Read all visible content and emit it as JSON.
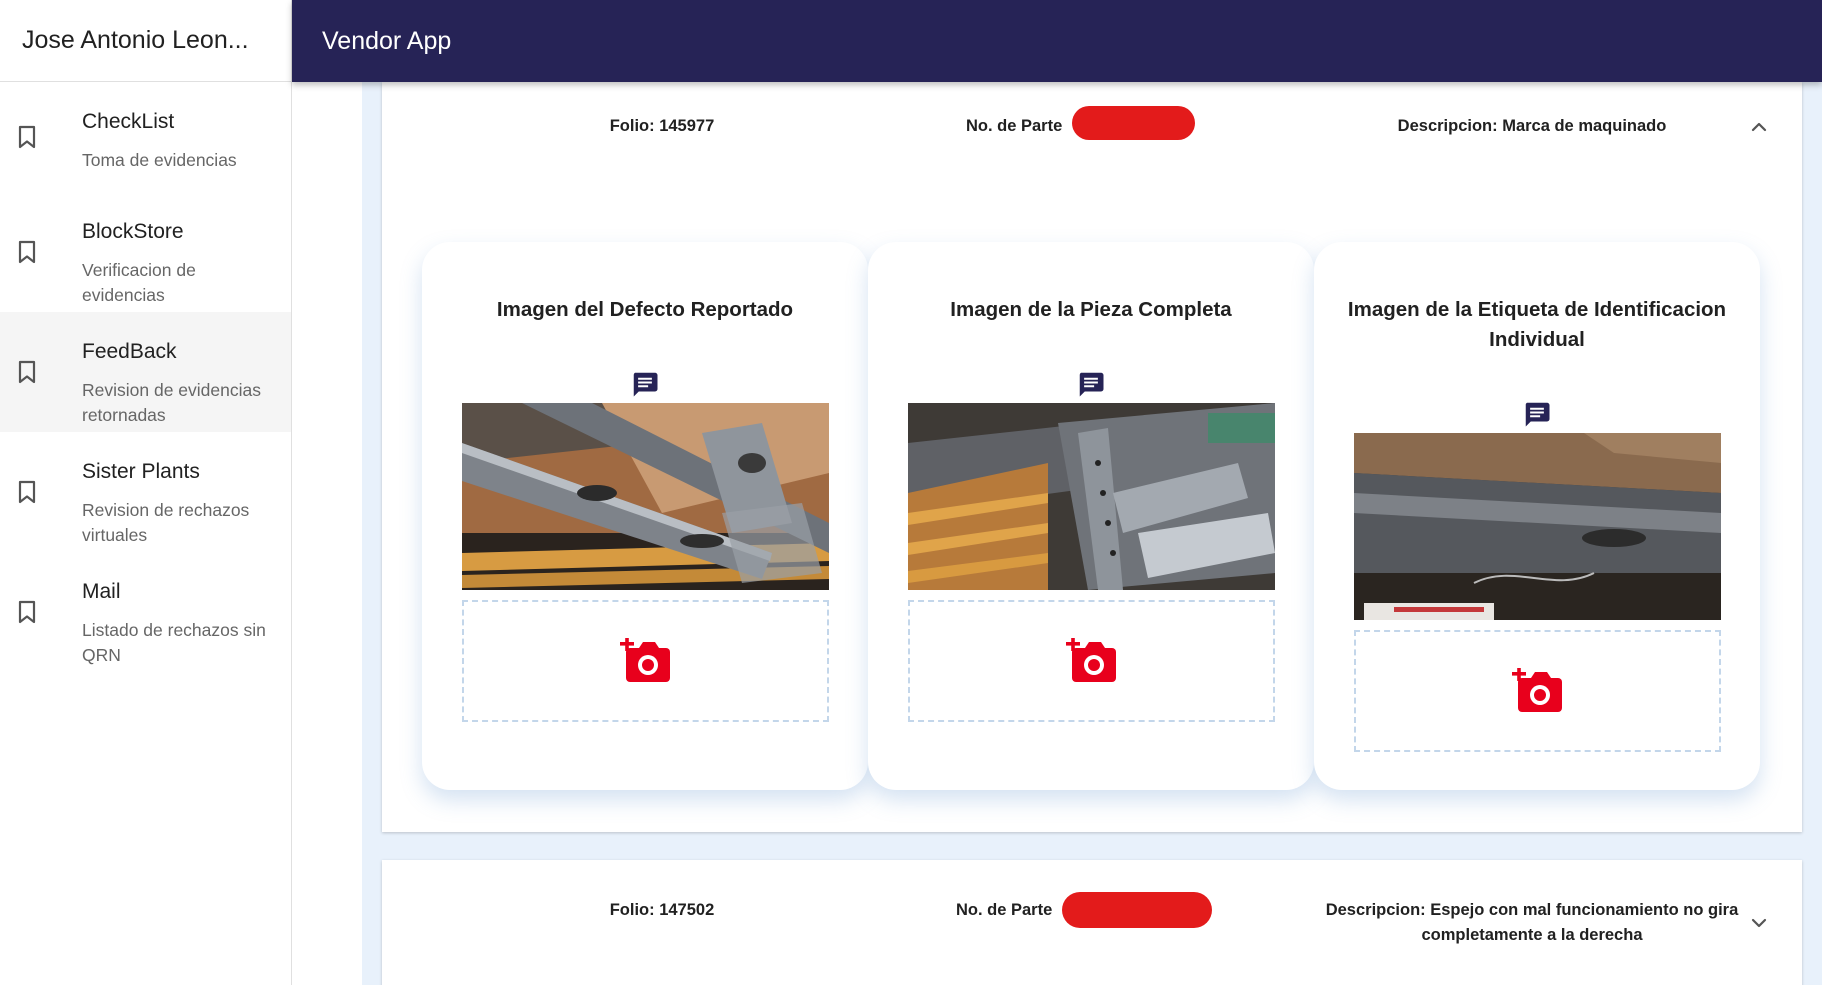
{
  "user": {
    "name": "Jose Antonio Leon..."
  },
  "app": {
    "title": "Vendor App"
  },
  "sidebar": {
    "items": [
      {
        "title": "CheckList",
        "subtitle": "Toma de evidencias"
      },
      {
        "title": "BlockStore",
        "subtitle": "Verificacion de evidencias"
      },
      {
        "title": "FeedBack",
        "subtitle": "Revision de evidencias retornadas"
      },
      {
        "title": "Sister Plants",
        "subtitle": "Revision de rechazos virtuales"
      },
      {
        "title": "Mail",
        "subtitle": "Listado de rechazos sin QRN"
      }
    ]
  },
  "records": [
    {
      "folio": "Folio: 145977",
      "part_label": "No. de Parte",
      "description": "Descripcion: Marca de maquinado",
      "expanded": true,
      "cards": [
        {
          "title": "Imagen del Defecto Reportado"
        },
        {
          "title": "Imagen de la Pieza Completa"
        },
        {
          "title": "Imagen de la Etiqueta de Identificacion Individual"
        }
      ]
    },
    {
      "folio": "Folio: 147502",
      "part_label": "No. de Parte",
      "description": "Descripcion: Espejo con mal funcionamiento no gira completamente a la derecha",
      "expanded": false
    }
  ],
  "icons": {
    "nav": "bookmark-icon",
    "collapse": "chevron-up-icon",
    "expand": "chevron-down-icon",
    "comment": "comment-icon",
    "add_photo": "add-photo-icon"
  },
  "colors": {
    "appbar": "#262356",
    "accent_icon": "#262356",
    "camera": "#e8001c",
    "redaction": "#e31b1b",
    "content_bg": "#e8f1fb"
  }
}
